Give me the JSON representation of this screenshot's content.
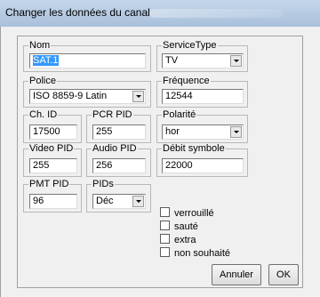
{
  "window": {
    "title": "Changer les données du canal"
  },
  "fields": {
    "nom": {
      "label": "Nom",
      "value": "SAT.1"
    },
    "service_type": {
      "label": "ServiceType",
      "value": "TV"
    },
    "police": {
      "label": "Police",
      "value": "ISO 8859-9 Latin"
    },
    "frequence": {
      "label": "Fréquence",
      "value": "12544"
    },
    "ch_id": {
      "label": "Ch. ID",
      "value": "17500"
    },
    "pcr_pid": {
      "label": "PCR PID",
      "value": "255"
    },
    "polarite": {
      "label": "Polarité",
      "value": "hor"
    },
    "video_pid": {
      "label": "Video PID",
      "value": "255"
    },
    "audio_pid": {
      "label": "Audio PID",
      "value": "256"
    },
    "debit_symbole": {
      "label": "Débit symbole",
      "value": "22000"
    },
    "pmt_pid": {
      "label": "PMT PID",
      "value": "96"
    },
    "pids": {
      "label": "PIDs",
      "value": "Déc"
    }
  },
  "checkboxes": [
    {
      "label": "verrouillé",
      "checked": false
    },
    {
      "label": "sauté",
      "checked": false
    },
    {
      "label": "extra",
      "checked": false
    },
    {
      "label": "non souhaité",
      "checked": false
    }
  ],
  "buttons": {
    "cancel": "Annuler",
    "ok": "OK"
  }
}
